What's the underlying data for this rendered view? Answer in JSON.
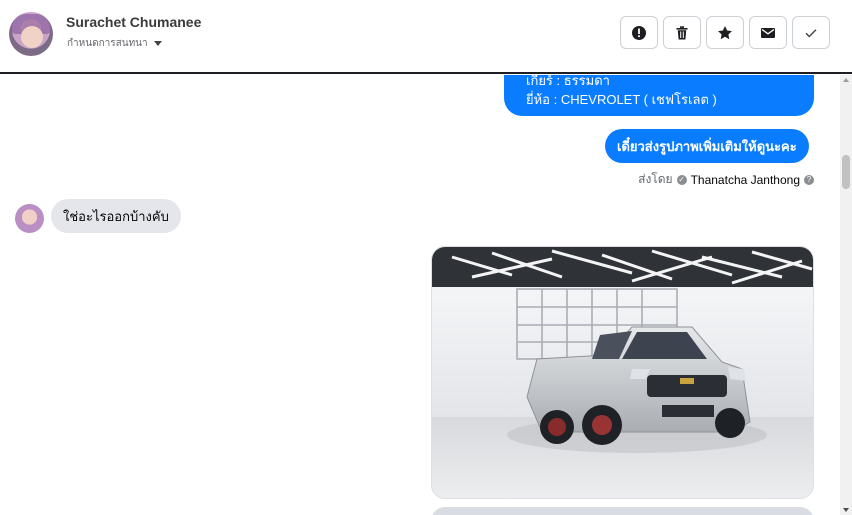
{
  "header": {
    "name": "Surachet Chumanee",
    "assign_label": "กำหนดการสนทนา",
    "actions": [
      {
        "name": "mark-spam-button",
        "icon": "alert-icon"
      },
      {
        "name": "delete-button",
        "icon": "trash-icon"
      },
      {
        "name": "star-button",
        "icon": "star-icon"
      },
      {
        "name": "mark-unread-button",
        "icon": "envelope-icon"
      },
      {
        "name": "mark-done-button",
        "icon": "check-icon"
      }
    ]
  },
  "messages": {
    "outgoing_1": {
      "line1": "เกียร์ : ธรรมดา",
      "line2": "ยี่ห้อ : CHEVROLET ( เชฟโรเลต )"
    },
    "outgoing_2": "เดี๋ยวส่งรูปภาพเพิ่มเติมให้ดูนะคะ",
    "sent_by_label": "ส่งโดย",
    "sent_by_name": "Thanatcha Janthong",
    "incoming_1": "ใช่อะไรออกบ้างคับ"
  },
  "colors": {
    "outgoing_bubble": "#0a7cff",
    "incoming_bubble": "#e4e6eb"
  }
}
